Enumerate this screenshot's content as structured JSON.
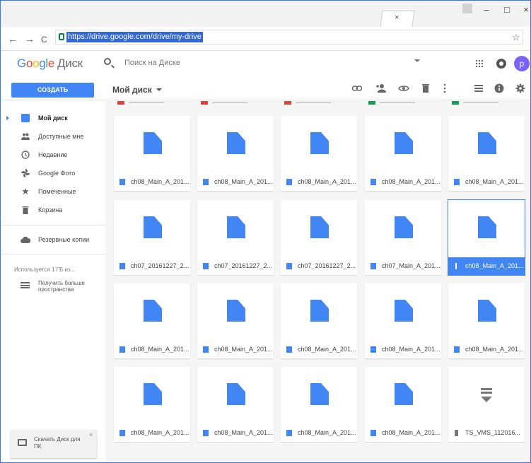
{
  "chrome": {
    "tab_close": "×",
    "window_controls": {
      "minimize": "–",
      "maximize": "□",
      "close": "×"
    },
    "nav": {
      "back": "←",
      "forward": "→",
      "reload": "C"
    },
    "url": "https://drive.google.com/drive/my-drive",
    "star": "☆",
    "more": "⋮"
  },
  "header": {
    "logo": {
      "g": "G",
      "o1": "o",
      "o2": "o",
      "g2": "g",
      "l": "l",
      "e": "e"
    },
    "product": "Диск",
    "search_placeholder": "Поиск на Диске",
    "avatar_letter": "p"
  },
  "toolbar": {
    "create": "СОЗДАТЬ",
    "breadcrumb": "Мой диск"
  },
  "sidebar": {
    "items": [
      {
        "label": "Мой диск",
        "icon": "drive-icon",
        "active": true
      },
      {
        "label": "Доступные мне",
        "icon": "shared-icon"
      },
      {
        "label": "Недавние",
        "icon": "clock-icon"
      },
      {
        "label": "Google Фото",
        "icon": "photos-icon"
      },
      {
        "label": "Помеченные",
        "icon": "star-icon"
      },
      {
        "label": "Корзина",
        "icon": "trash-icon"
      },
      {
        "label": "Резервные копии",
        "icon": "cloud-icon"
      }
    ],
    "storage": "Используется 1 ГБ из...",
    "get_more": "Получить больше пространства",
    "download_card": {
      "text": "Скачать Диск для ПК",
      "close": "×"
    }
  },
  "files": [
    [
      "ch08_Main_A_201...",
      "ch08_Main_A_201...",
      "ch08_Main_A_201...",
      "ch08_Main_A_201...",
      "ch08_Main_A_201..."
    ],
    [
      "ch07_20161227_2...",
      "ch07_20161227_2...",
      "ch07_20161227_2...",
      "ch07_Main_A_201...",
      "ch08_Main_A_201..."
    ],
    [
      "ch08_Main_A_201...",
      "ch08_Main_A_201...",
      "ch08_Main_A_201...",
      "ch08_Main_A_201...",
      "ch08_Main_A_201..."
    ],
    [
      "ch08_Main_A_201...",
      "ch08_Main_A_201...",
      "ch08_Main_A_201...",
      "ch08_Main_A_201...",
      "TS_VMS_112016..."
    ]
  ],
  "selected_file": {
    "row": 1,
    "col": 4
  },
  "colors": {
    "accent": "#4285f4",
    "avatar": "#7b61ff",
    "url_highlight": "#3367d6"
  }
}
